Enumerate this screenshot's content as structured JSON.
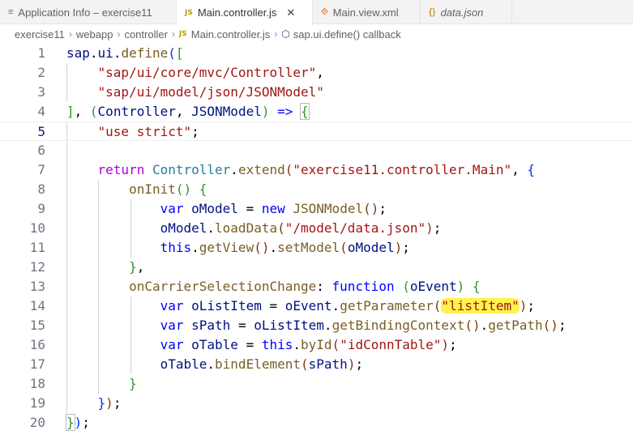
{
  "tabs": [
    {
      "label": "Application Info – exercise11",
      "icon": "info-lines-icon",
      "glyph": "≡",
      "active": false
    },
    {
      "label": "Main.controller.js",
      "icon": "js-file-icon",
      "glyph": "JS",
      "active": true,
      "close": "✕"
    },
    {
      "label": "Main.view.xml",
      "icon": "rss-xml-file-icon",
      "glyph": "⟐",
      "active": false
    },
    {
      "label": "data.json",
      "icon": "json-braces-icon",
      "glyph": "{}",
      "active": false
    }
  ],
  "breadcrumb": {
    "project": "exercise11",
    "folder1": "webapp",
    "folder2": "controller",
    "js_badge": "JS",
    "file": "Main.controller.js",
    "symbol": "sap.ui.define() callback",
    "separator": "›"
  },
  "editor": {
    "current_line": 5,
    "line_numbers": [
      "1",
      "2",
      "3",
      "4",
      "5",
      "6",
      "7",
      "8",
      "9",
      "10",
      "11",
      "12",
      "13",
      "14",
      "15",
      "16",
      "17",
      "18",
      "19",
      "20"
    ],
    "code": {
      "l1_a": "sap",
      "l1_b": ".",
      "l1_c": "ui",
      "l1_d": ".",
      "l1_e": "define",
      "l1_f": "(",
      "l1_g": "[",
      "l2": "\"sap/ui/core/mvc/Controller\"",
      "l2_comma": ",",
      "l3": "\"sap/ui/model/json/JSONModel\"",
      "l4_a": "]",
      "l4_b": ", ",
      "l4_c": "(",
      "l4_d": "Controller",
      "l4_e": ", ",
      "l4_f": "JSONModel",
      "l4_g": ")",
      "l4_h": " => ",
      "l4_i": "{",
      "l5_a": "\"use strict\"",
      "l5_b": ";",
      "l7_a": "return",
      "l7_b": "Controller",
      "l7_c": ".",
      "l7_d": "extend",
      "l7_e": "(",
      "l7_f": "\"exercise11.controller.Main\"",
      "l7_g": ", ",
      "l7_h": "{",
      "l8_a": "onInit",
      "l8_b": "()",
      "l8_c": " {",
      "l9_a": "var",
      "l9_b": "oModel",
      "l9_c": " = ",
      "l9_d": "new",
      "l9_e": "JSONModel",
      "l9_f": "()",
      "l9_g": ";",
      "l10_a": "oModel",
      "l10_b": ".",
      "l10_c": "loadData",
      "l10_d": "(",
      "l10_e": "\"/model/data.json\"",
      "l10_f": ")",
      "l10_g": ";",
      "l11_a": "this",
      "l11_b": ".",
      "l11_c": "getView",
      "l11_d": "()",
      "l11_e": ".",
      "l11_f": "setModel",
      "l11_g": "(",
      "l11_h": "oModel",
      "l11_i": ")",
      "l11_j": ";",
      "l12_a": "}",
      "l12_b": ",",
      "l13_a": "onCarrierSelectionChange",
      "l13_b": ": ",
      "l13_c": "function",
      "l13_d": " (",
      "l13_e": "oEvent",
      "l13_f": ")",
      "l13_g": " {",
      "l14_a": "var",
      "l14_b": "oListItem",
      "l14_c": " = ",
      "l14_d": "oEvent",
      "l14_e": ".",
      "l14_f": "getParameter",
      "l14_g": "(",
      "l14_h": "\"listItem\"",
      "l14_i": ")",
      "l14_j": ";",
      "l15_a": "var",
      "l15_b": "sPath",
      "l15_c": " = ",
      "l15_d": "oListItem",
      "l15_e": ".",
      "l15_f": "getBindingContext",
      "l15_g": "()",
      "l15_h": ".",
      "l15_i": "getPath",
      "l15_j": "()",
      "l15_k": ";",
      "l16_a": "var",
      "l16_b": "oTable",
      "l16_c": " = ",
      "l16_d": "this",
      "l16_e": ".",
      "l16_f": "byId",
      "l16_g": "(",
      "l16_h": "\"idConnTable\"",
      "l16_i": ")",
      "l16_j": ";",
      "l17_a": "oTable",
      "l17_b": ".",
      "l17_c": "bindElement",
      "l17_d": "(",
      "l17_e": "sPath",
      "l17_f": ")",
      "l17_g": ";",
      "l18": "}",
      "l19_a": "}",
      "l19_b": ")",
      "l19_c": ";",
      "l20_a": "}",
      "l20_b": ")",
      "l20_c": ";"
    }
  },
  "colors": {
    "keyword": "#0000ff",
    "control_keyword": "#af00db",
    "string": "#a31515",
    "variable": "#001080",
    "function": "#795e26",
    "type": "#267f99",
    "highlight": "#fff34d"
  }
}
